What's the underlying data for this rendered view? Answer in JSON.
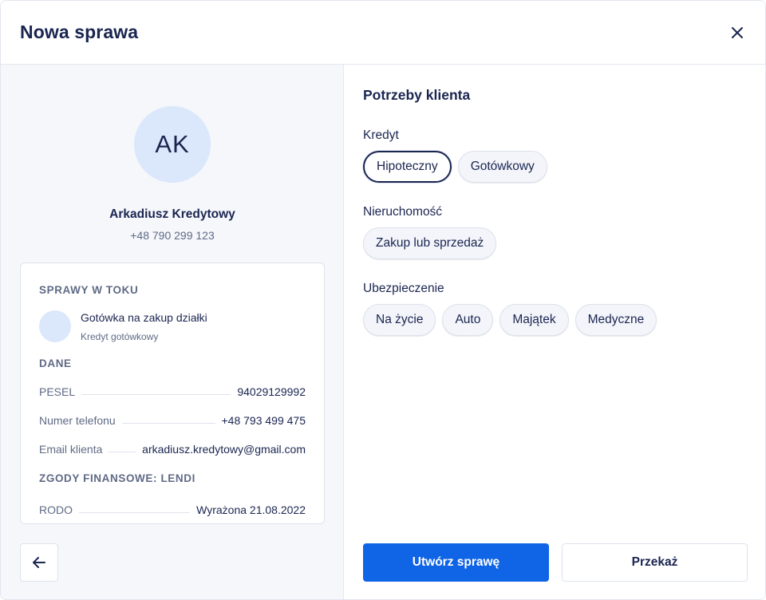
{
  "header": {
    "title": "Nowa sprawa",
    "close_icon": "close-icon"
  },
  "client": {
    "initials": "AK",
    "name": "Arkadiusz Kredytowy",
    "phone": "+48 790 299 123"
  },
  "details": {
    "cases_heading": "SPRAWY W TOKU",
    "case": {
      "title": "Gotówka na zakup działki",
      "subtitle": "Kredyt gotówkowy"
    },
    "data_heading": "DANE",
    "fields": [
      {
        "label": "PESEL",
        "value": "94029129992"
      },
      {
        "label": "Numer telefonu",
        "value": "+48 793 499 475"
      },
      {
        "label": "Email klienta",
        "value": "arkadiusz.kredytowy@gmail.com"
      }
    ],
    "consents_heading": "ZGODY FINANSOWE: LENDI",
    "consents": [
      {
        "label": "RODO",
        "value": "Wyrażona 21.08.2022"
      }
    ]
  },
  "back_icon": "arrow-left-icon",
  "needs": {
    "title": "Potrzeby klienta",
    "groups": [
      {
        "label": "Kredyt",
        "options": [
          "Hipoteczny",
          "Gotówkowy"
        ],
        "selected": "Hipoteczny"
      },
      {
        "label": "Nieruchomość",
        "options": [
          "Zakup lub sprzedaż"
        ],
        "selected": ""
      },
      {
        "label": "Ubezpieczenie",
        "options": [
          "Na życie",
          "Auto",
          "Majątek",
          "Medyczne"
        ],
        "selected": ""
      }
    ]
  },
  "actions": {
    "create_label": "Utwórz sprawę",
    "transfer_label": "Przekaż"
  },
  "colors": {
    "primary": "#1064e6",
    "text": "#1a2550",
    "muted": "#5f6a85",
    "avatar_bg": "#dbe8fb",
    "panel_bg": "#f5f7fb"
  }
}
